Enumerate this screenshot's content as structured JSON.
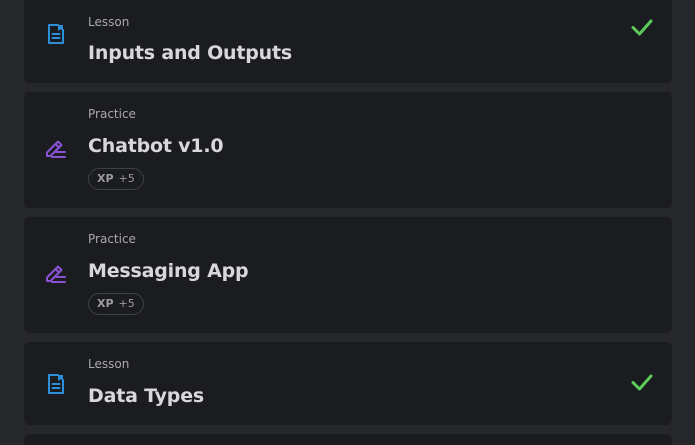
{
  "items": [
    {
      "kind": "Lesson",
      "title": "Inputs and Outputs",
      "completed": true,
      "icon": "lesson-document-icon"
    },
    {
      "kind": "Practice",
      "title": "Chatbot v1.0",
      "xp_label": "XP",
      "xp_value": "+5",
      "icon": "practice-pencil-icon"
    },
    {
      "kind": "Practice",
      "title": "Messaging App",
      "xp_label": "XP",
      "xp_value": "+5",
      "icon": "practice-pencil-icon"
    },
    {
      "kind": "Lesson",
      "title": "Data Types",
      "completed": true,
      "icon": "lesson-document-icon"
    }
  ],
  "colors": {
    "background": "#26272a",
    "card": "#1b1c1f",
    "lesson_icon": "#2b8fdc",
    "practice_icon": "#8b52d6",
    "check": "#5ccb5a",
    "title": "#d8d8da",
    "kind": "#a8a9ac"
  }
}
